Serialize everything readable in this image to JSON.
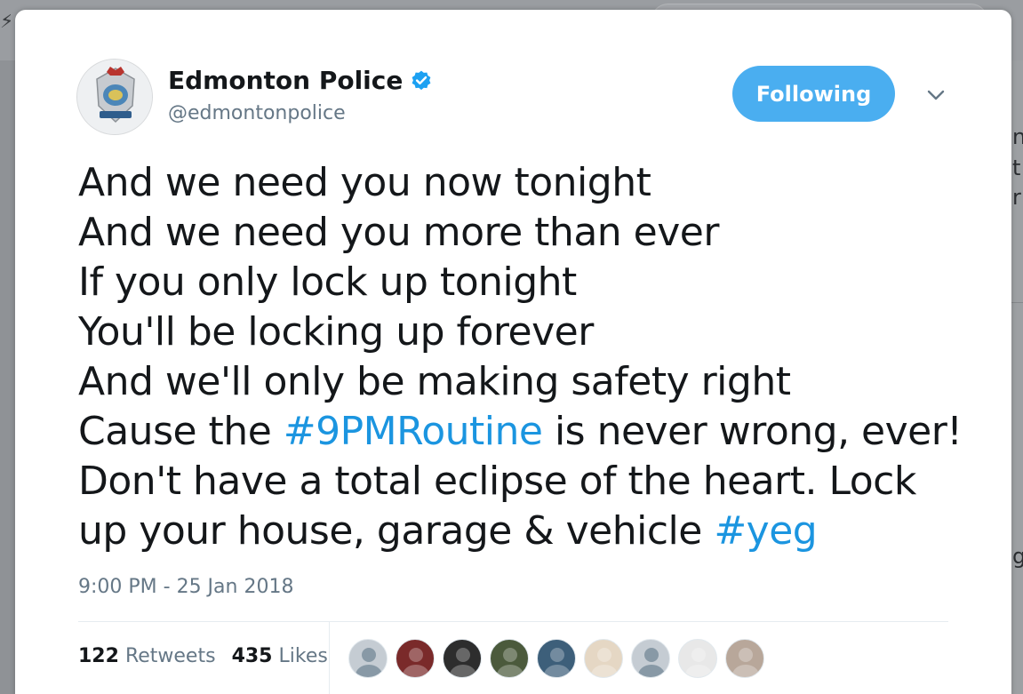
{
  "account": {
    "name": "Edmonton Police",
    "handle": "@edmontonpolice",
    "verified": true,
    "avatar_icon": "police-crest-icon"
  },
  "follow_button": {
    "label": "Following",
    "color": "#4aaef0"
  },
  "more_menu": {
    "icon": "chevron-down-icon"
  },
  "tweet": {
    "lines": [
      "And we need you now tonight",
      "And we need you more than ever",
      "If you only lock up tonight",
      "You'll be locking up forever",
      "And we'll only be making safety right"
    ],
    "line6_pre": "Cause the ",
    "line6_hashtag": "#9PMRoutine",
    "line6_post": " is never wrong, ever!",
    "line7": "Don't have a total eclipse of the heart. Lock",
    "line8_pre": "up your house, garage & vehicle ",
    "line8_hashtag": "#yeg",
    "hashtag_color": "#1b95e0"
  },
  "timestamp": "9:00 PM - 25 Jan 2018",
  "stats": {
    "retweets_count": "122",
    "retweets_label": "Retweets",
    "likes_count": "435",
    "likes_label": "Likes"
  },
  "likers": [
    {
      "icon": "default-avatar-icon",
      "color": "#c5ccd3"
    },
    {
      "icon": "user-avatar-icon",
      "color": "#7a2a2a"
    },
    {
      "icon": "user-avatar-icon",
      "color": "#2d2d2d"
    },
    {
      "icon": "user-avatar-icon",
      "color": "#4b5a3c"
    },
    {
      "icon": "user-avatar-icon",
      "color": "#3d5f7a"
    },
    {
      "icon": "user-avatar-icon",
      "color": "#e5d7c4"
    },
    {
      "icon": "default-avatar-icon",
      "color": "#c5ccd3"
    },
    {
      "icon": "user-avatar-icon",
      "color": "#e8e8e8"
    },
    {
      "icon": "user-avatar-icon",
      "color": "#b8a79a"
    }
  ]
}
